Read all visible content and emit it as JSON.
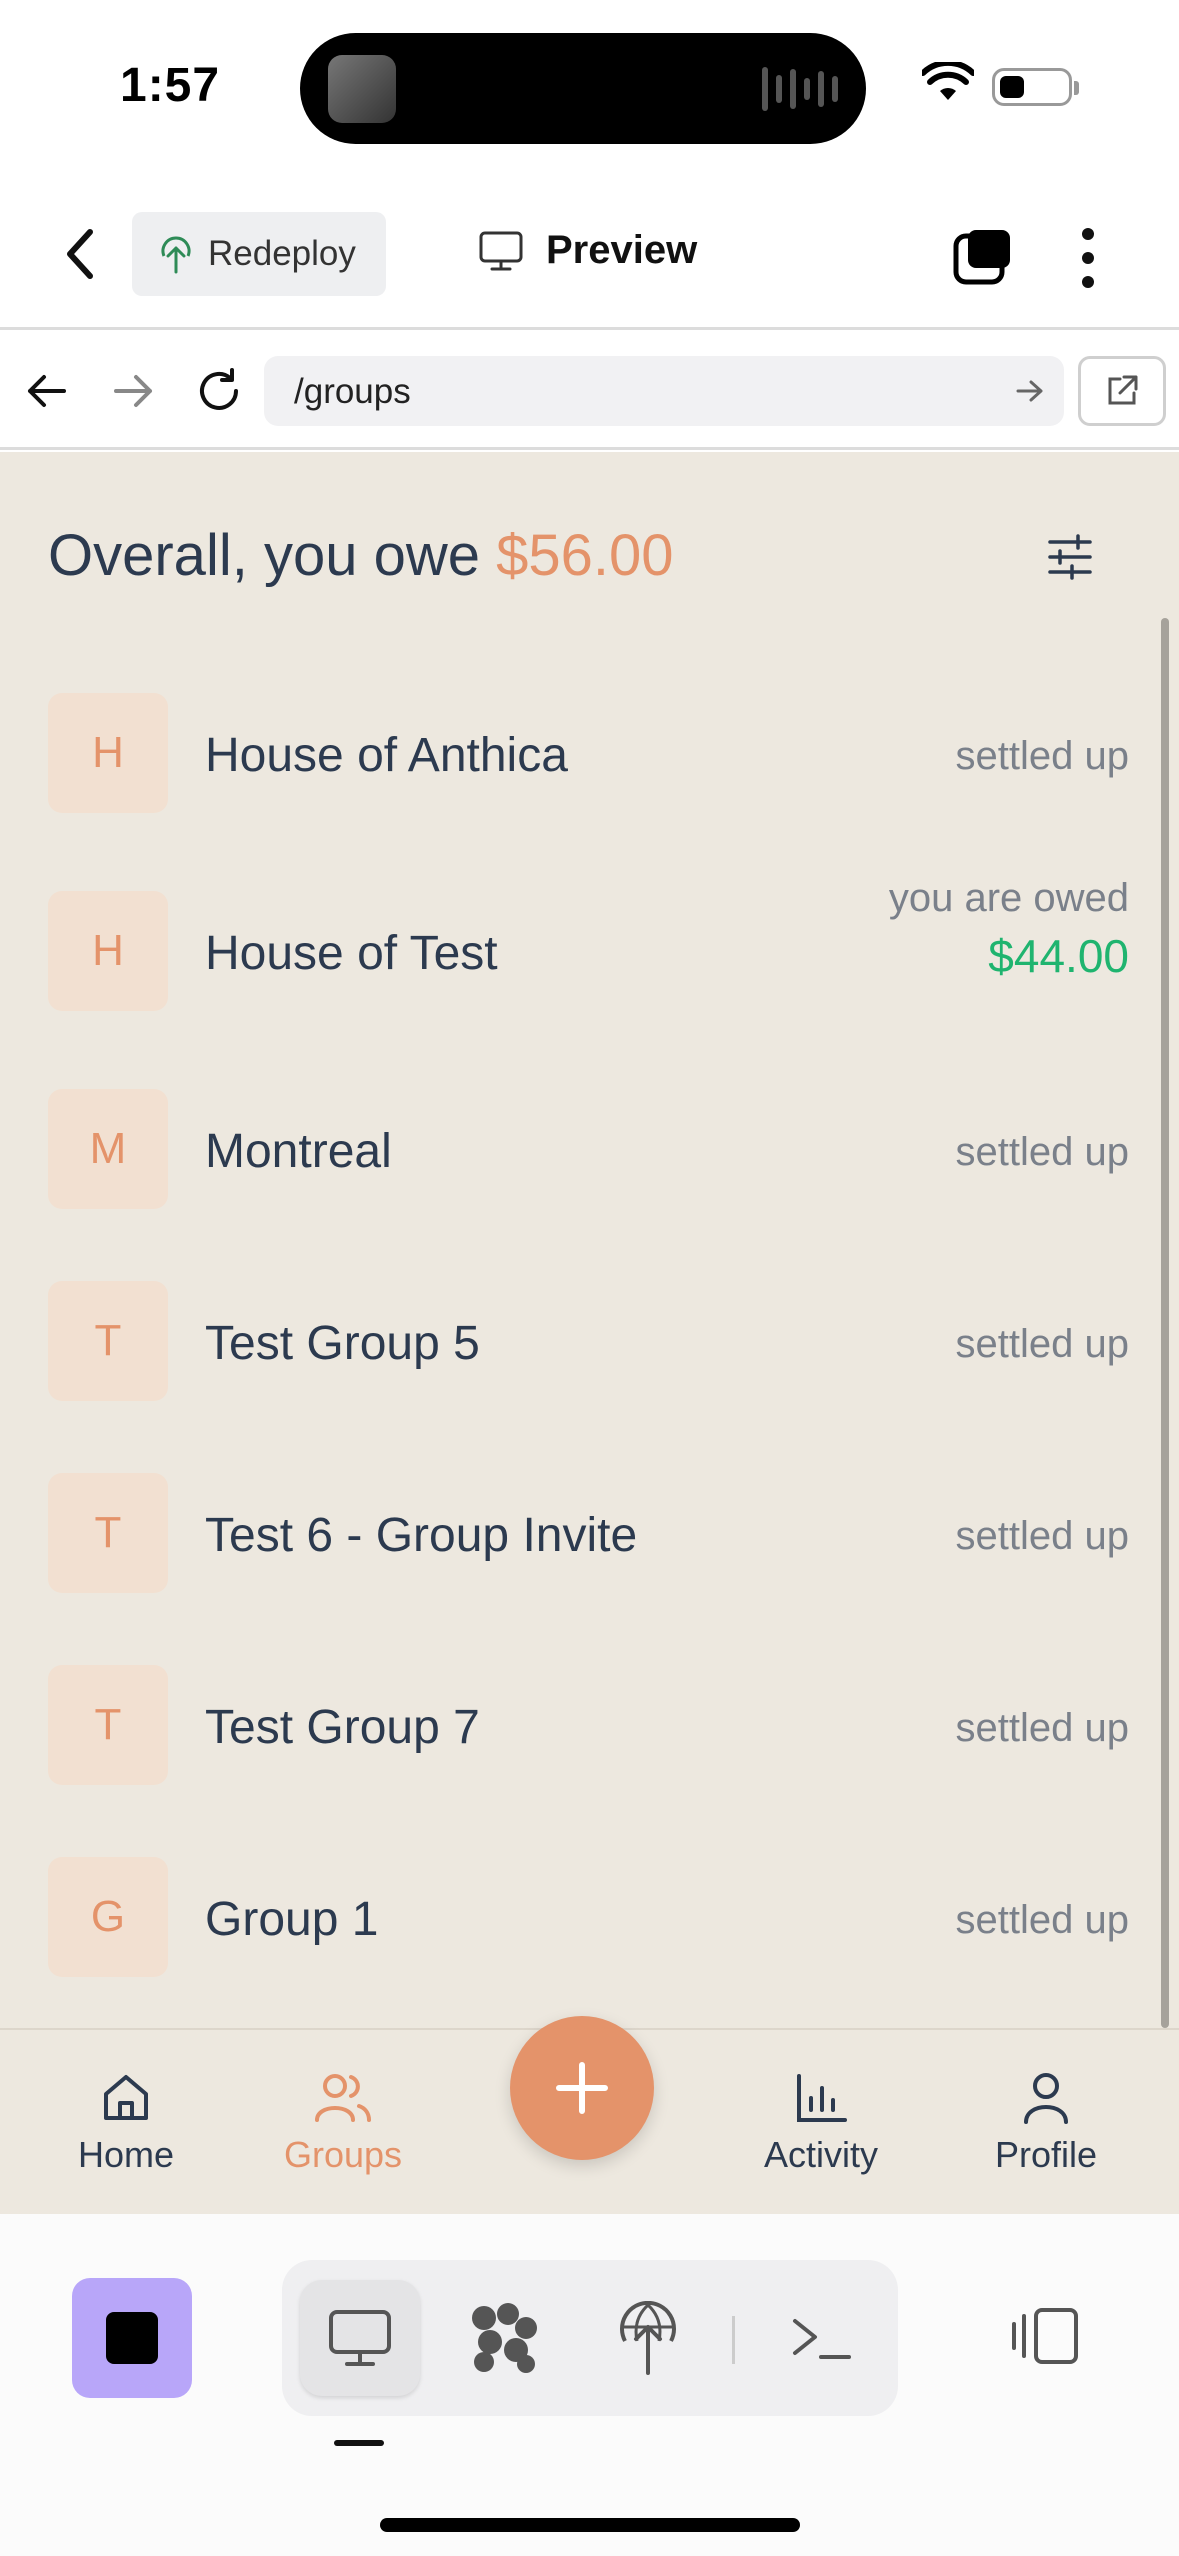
{
  "status_bar": {
    "time": "1:57"
  },
  "toolbar": {
    "redeploy_label": "Redeploy",
    "preview_label": "Preview"
  },
  "browser": {
    "url": "/groups"
  },
  "summary": {
    "prefix": "Overall, you owe ",
    "amount": "$56.00"
  },
  "groups": [
    {
      "initial": "H",
      "name": "House of Anthica",
      "status": "settled up",
      "amount": ""
    },
    {
      "initial": "H",
      "name": "House of Test",
      "status": "you are owed",
      "amount": "$44.00"
    },
    {
      "initial": "M",
      "name": "Montreal",
      "status": "settled up",
      "amount": ""
    },
    {
      "initial": "T",
      "name": "Test Group 5",
      "status": "settled up",
      "amount": ""
    },
    {
      "initial": "T",
      "name": "Test 6 - Group Invite",
      "status": "settled up",
      "amount": ""
    },
    {
      "initial": "T",
      "name": "Test Group 7",
      "status": "settled up",
      "amount": ""
    },
    {
      "initial": "G",
      "name": "Group 1",
      "status": "settled up",
      "amount": ""
    }
  ],
  "bottom_nav": {
    "home": "Home",
    "groups": "Groups",
    "activity": "Activity",
    "profile": "Profile",
    "active": "groups"
  },
  "colors": {
    "accent": "#e4936a",
    "positive": "#1fb46f",
    "background": "#ede8df",
    "text": "#2c3a4f"
  },
  "icons": [
    "back-chevron-icon",
    "redeploy-icon",
    "monitor-icon",
    "tabs-icon",
    "more-icon",
    "arrow-left-icon",
    "arrow-right-icon",
    "reload-icon",
    "external-link-icon",
    "filter-icon",
    "home-icon",
    "groups-icon",
    "plus-icon",
    "activity-icon",
    "profile-icon",
    "stop-icon",
    "preview-tool-icon",
    "nodes-tool-icon",
    "deploy-tool-icon",
    "terminal-tool-icon",
    "split-view-icon"
  ]
}
